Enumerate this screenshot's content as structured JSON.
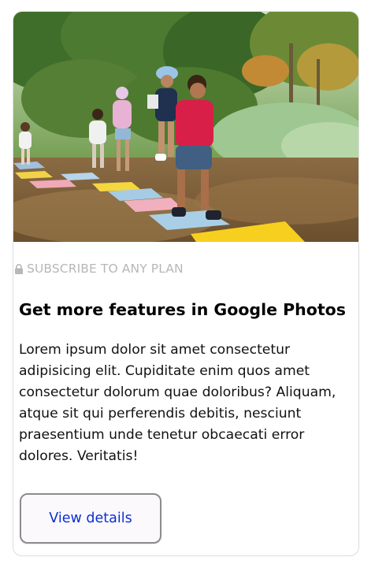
{
  "card": {
    "eyebrow_label": "SUBSCRIBE TO ANY PLAN",
    "title": "Get more features in Google Photos",
    "description": "Lorem ipsum dolor sit amet consectetur adipisicing elit. Cupiditate enim quos amet consectetur dolorum quae doloribus? Aliquam, atque sit qui perferendis debitis, nesciunt praesentium unde tenetur obcaecati error dolores. Veritatis!",
    "button_label": "View details"
  },
  "colors": {
    "eyebrow": "#b7b7b7",
    "button_text": "#0b2fd0",
    "button_border": "#8c8c8c",
    "card_border": "#dcdcdc"
  },
  "icons": {
    "eyebrow": "lock-icon"
  }
}
